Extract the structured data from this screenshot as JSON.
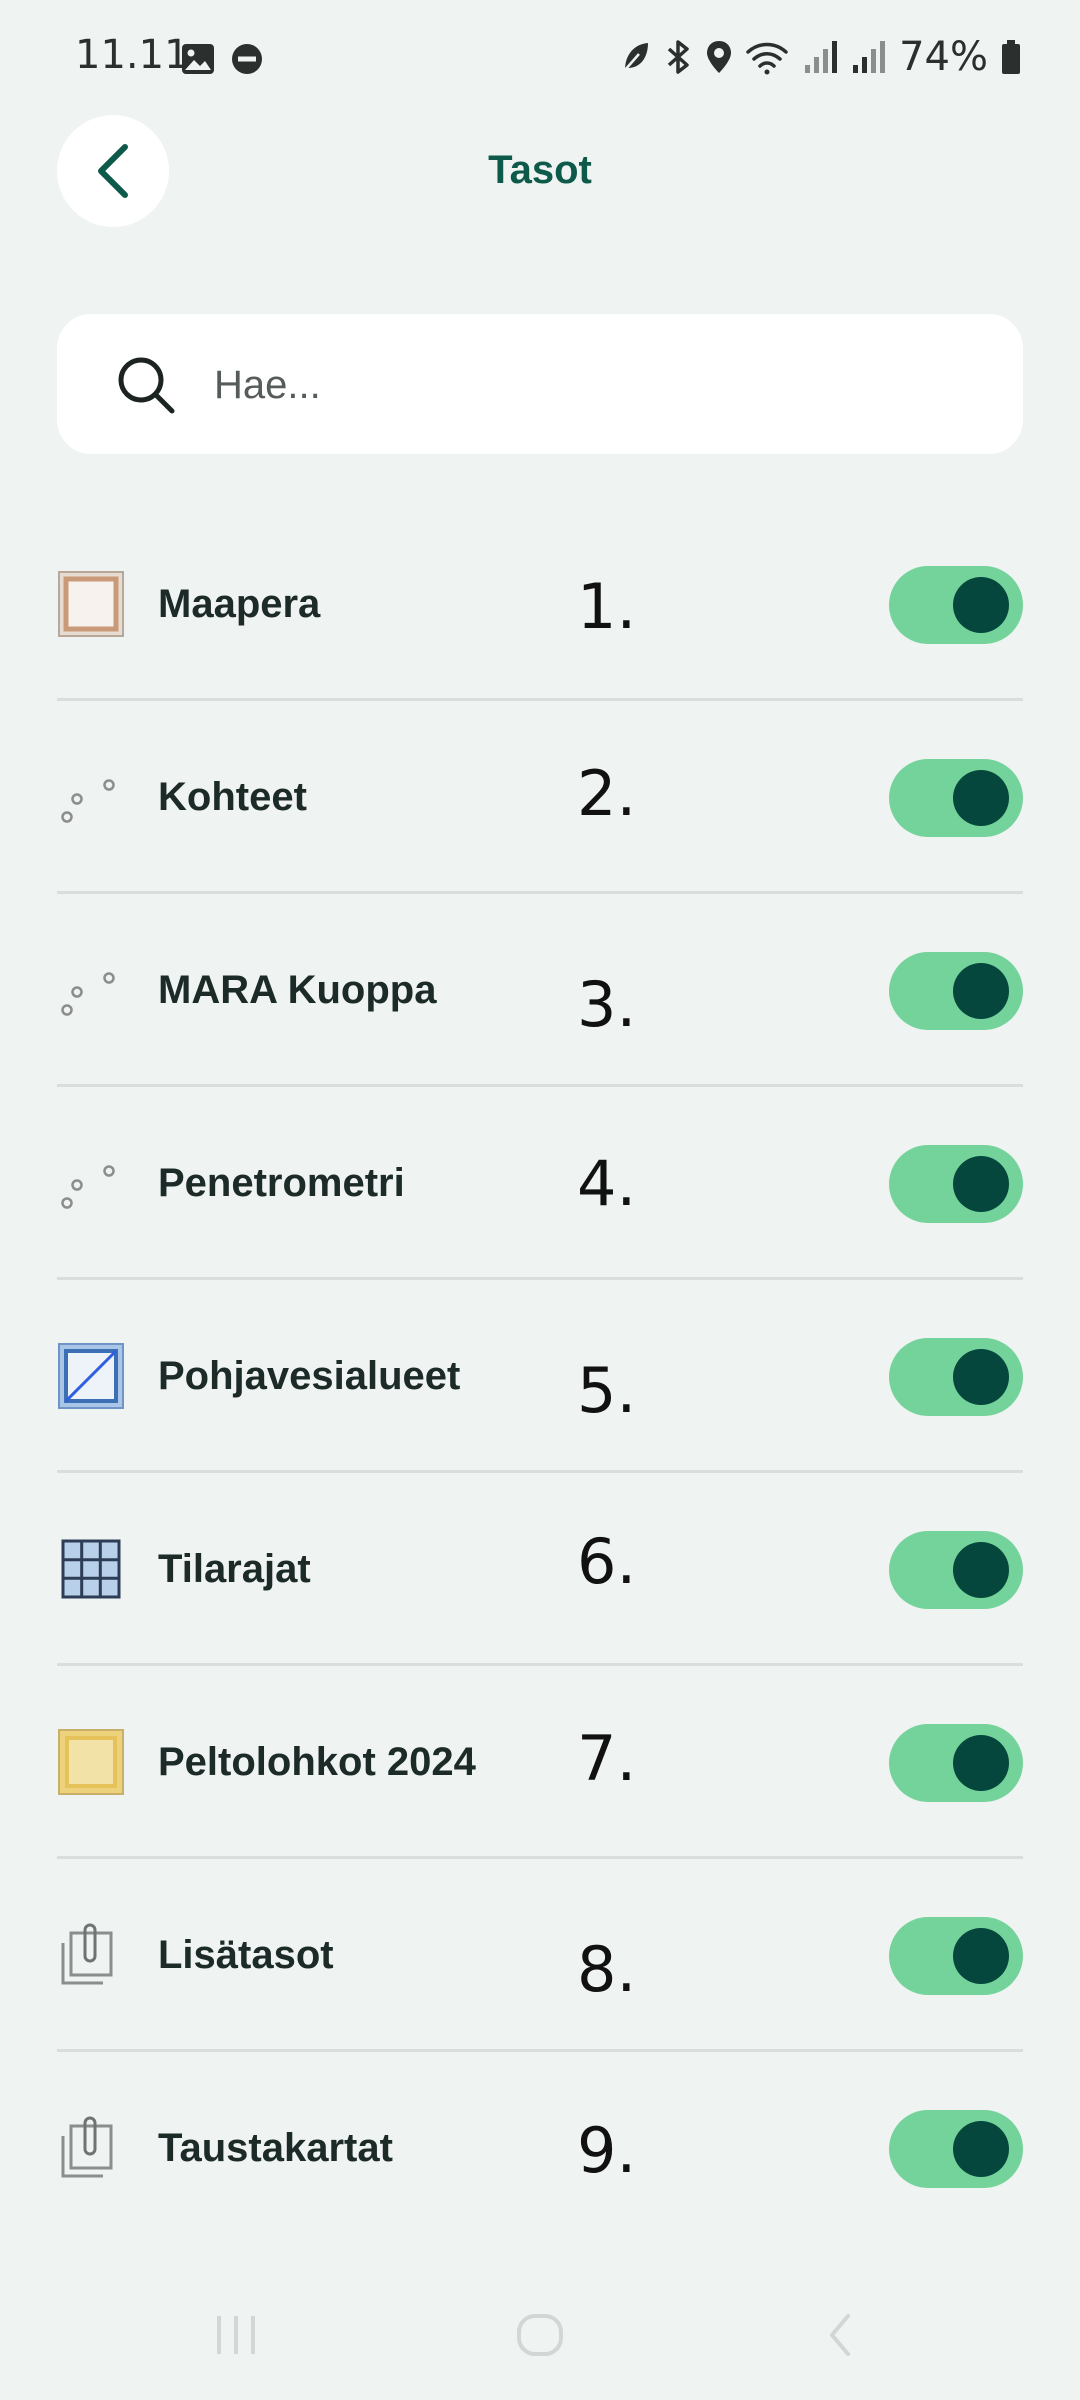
{
  "status_bar": {
    "time": "11.11",
    "battery": "74%"
  },
  "header": {
    "title": "Tasot",
    "back_icon": "chevron-left-icon"
  },
  "search": {
    "placeholder": "Hae...",
    "value": ""
  },
  "layers": [
    {
      "label": "Maapera",
      "number": "1.",
      "icon": "polygon-brown-icon",
      "enabled": true
    },
    {
      "label": "Kohteet",
      "number": "2.",
      "icon": "points-icon",
      "enabled": true
    },
    {
      "label": "MARA Kuoppa",
      "number": "3.",
      "icon": "points-icon",
      "enabled": true
    },
    {
      "label": "Penetrometri",
      "number": "4.",
      "icon": "points-icon",
      "enabled": true
    },
    {
      "label": "Pohjavesialueet",
      "number": "5.",
      "icon": "polygon-blue-hatched-icon",
      "enabled": true
    },
    {
      "label": "Tilarajat",
      "number": "6.",
      "icon": "grid-icon",
      "enabled": true
    },
    {
      "label": "Peltolohkot 2024",
      "number": "7.",
      "icon": "polygon-yellow-icon",
      "enabled": true
    },
    {
      "label": "Lisätasot",
      "number": "8.",
      "icon": "layers-group-icon",
      "enabled": true
    },
    {
      "label": "Taustakartat",
      "number": "9.",
      "icon": "layers-group-icon",
      "enabled": true
    }
  ],
  "colors": {
    "accent": "#0e5a4a",
    "toggle_track": "#74d39a",
    "toggle_knob": "#06473d",
    "background": "#eff3f2"
  }
}
